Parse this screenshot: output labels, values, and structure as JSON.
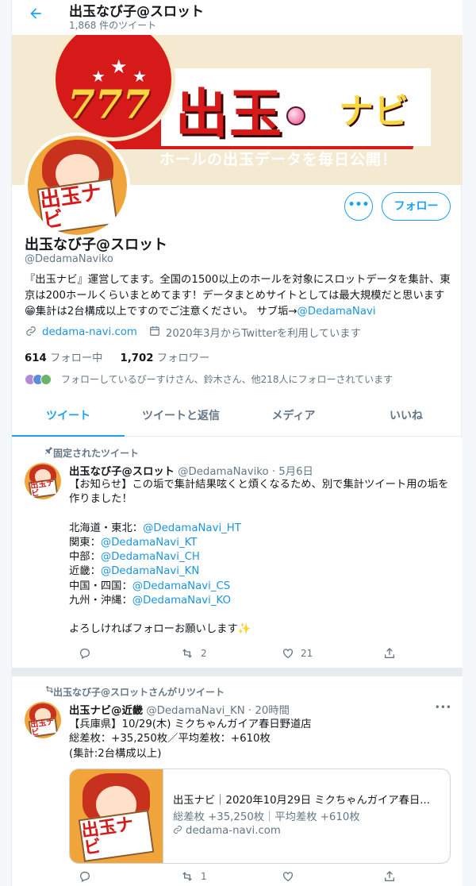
{
  "header": {
    "title": "出玉なび子@スロット",
    "tweet_count": "1,868 件のツイート"
  },
  "banner": {
    "number": "777",
    "title": "出玉",
    "title_suffix": "ナビ",
    "subtitle": "ホールの出玉データを毎日公開！"
  },
  "avatar_sign": "出玉ナビ",
  "profile": {
    "name": "出玉なび子@スロット",
    "handle": "@DedamaNaviko",
    "bio": "『出玉ナビ』運営してます。全国の1500以上のホールを対象にスロットデータを集計、東京は200ホールくらいまとめてます！データまとめサイトとしては最大規模だと思います😁集計は2台構成以上ですのでご注意ください。 サブ垢→",
    "bio_link": "@DedamaNavi",
    "website": "dedama-navi.com",
    "joined": "2020年3月からTwitterを利用しています",
    "following_count": "614",
    "following_label": "フォロー中",
    "followers_count": "1,702",
    "followers_label": "フォロワー",
    "known_followers": "フォローしているぴーすけさん、鈴木さん、他218人にフォローされています",
    "more_button": "•••",
    "follow_button": "フォロー"
  },
  "tabs": [
    {
      "label": "ツイート",
      "active": true
    },
    {
      "label": "ツイートと返信",
      "active": false
    },
    {
      "label": "メディア",
      "active": false
    },
    {
      "label": "いいね",
      "active": false
    }
  ],
  "tweet1": {
    "context": "固定されたツイート",
    "name": "出玉なび子@スロット",
    "meta": "@DedamaNaviko · 5月6日",
    "intro": "【お知らせ】この垢で集計結果呟くと煩くなるため、別で集計ツイート用の垢を作りました！",
    "lines": [
      {
        "label": "北海道・東北：",
        "link": "@DedamaNavi_HT"
      },
      {
        "label": "関東：",
        "link": "@DedamaNavi_KT"
      },
      {
        "label": "中部：",
        "link": "@DedamaNavi_CH"
      },
      {
        "label": "近畿：",
        "link": "@DedamaNavi_KN"
      },
      {
        "label": "中国・四国：",
        "link": "@DedamaNavi_CS"
      },
      {
        "label": "九州・沖縄：",
        "link": "@DedamaNavi_KO"
      }
    ],
    "outro": "よろしければフォローお願いします✨",
    "reply_count": "",
    "retweet_count": "2",
    "like_count": "21"
  },
  "tweet2": {
    "context": "出玉なび子@スロットさんがリツイート",
    "name": "出玉ナビ@近畿",
    "meta": "@DedamaNavi_KN · 20時間",
    "line1": "【兵庫県】10/29(木) ミクちゃんガイア春日野道店",
    "line2": "総差枚：+35,250枚／平均差枚：+610枚",
    "line3": "(集計:2台構成以上)",
    "card_title": "出玉ナビ｜2020年10月29日 ミクちゃんガイア春日...",
    "card_desc": "総差枚 +35,250枚｜平均差枚 +610枚",
    "card_url": "dedama-navi.com",
    "retweet_count": "1"
  },
  "colors": {
    "accent": "#1da1f2",
    "banner_red": "#d61a1a",
    "banner_gold": "#f7d640"
  },
  "icons": {
    "back": "arrow-left-icon",
    "link": "link-icon",
    "calendar": "calendar-icon",
    "pin": "pin-icon",
    "retweet": "retweet-icon",
    "reply": "reply-icon",
    "like": "heart-icon",
    "share": "share-icon"
  }
}
